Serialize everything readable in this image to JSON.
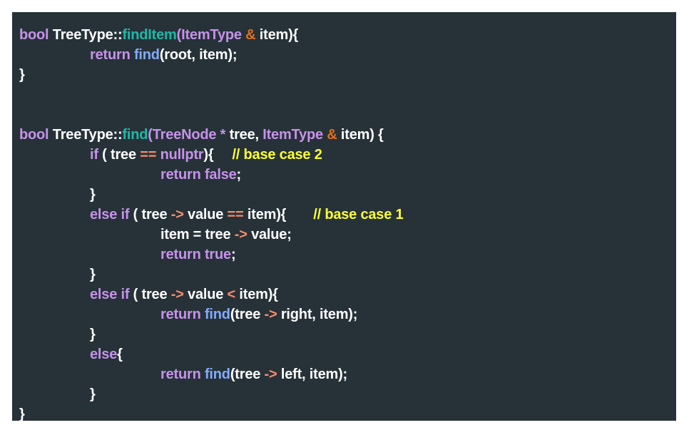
{
  "colors": {
    "background": "#263238",
    "plain": "#ffffff",
    "keyword": "#c792ea",
    "function": "#82aaff",
    "function_teal": "#1fb8a8",
    "operator": "#f78c6c",
    "ampersand": "#e36f1e",
    "comment": "#ffff33"
  },
  "code": {
    "l1": {
      "bool": "bool",
      "cls": " TreeType::",
      "fn": "findItem",
      "paren": "(",
      "type": "ItemType",
      "sp": " ",
      "amp": "&",
      "rest": " item){"
    },
    "l2": {
      "ret": "return",
      "fn": " find",
      "rest": "(root, item);"
    },
    "l3": {
      "brace": "}"
    },
    "l4": {
      "bool": "bool",
      "cls": " TreeType::",
      "fn": "find",
      "paren": "(",
      "type1": "TreeNode",
      "star": " *",
      "mid": " tree, ",
      "type2": "ItemType",
      "sp": " ",
      "amp": "&",
      "rest": " item) {"
    },
    "l5": {
      "if": "if",
      "a": " ( tree ",
      "eq": "==",
      "sp": " ",
      "null": "nullptr",
      "b": "){",
      "comment": "// base case 2"
    },
    "l6": {
      "ret": "return",
      "false": " false",
      "semi": ";"
    },
    "l7": {
      "brace": "}"
    },
    "l8": {
      "elseif": "else if",
      "a": " ( tree ",
      "arrow": "->",
      "b": " value ",
      "eq": "==",
      "c": " item){",
      "comment": "// base case 1"
    },
    "l9": {
      "a": "item = tree ",
      "arrow": "->",
      "b": " value;"
    },
    "l10": {
      "ret": "return",
      "true": " true",
      "semi": ";"
    },
    "l11": {
      "brace": "}"
    },
    "l12": {
      "elseif": "else if",
      "a": " ( tree ",
      "arrow": "->",
      "b": " value ",
      "lt": "<",
      "c": " item){"
    },
    "l13": {
      "ret": "return",
      "fn": " find",
      "a": "(tree ",
      "arrow": "->",
      "b": " right, item);"
    },
    "l14": {
      "brace": "}"
    },
    "l15": {
      "else": "else",
      "brace": "{"
    },
    "l16": {
      "ret": "return",
      "fn": " find",
      "a": "(tree ",
      "arrow": "->",
      "b": " left, item);"
    },
    "l17": {
      "brace": "}"
    },
    "l18": {
      "brace": "}"
    }
  }
}
